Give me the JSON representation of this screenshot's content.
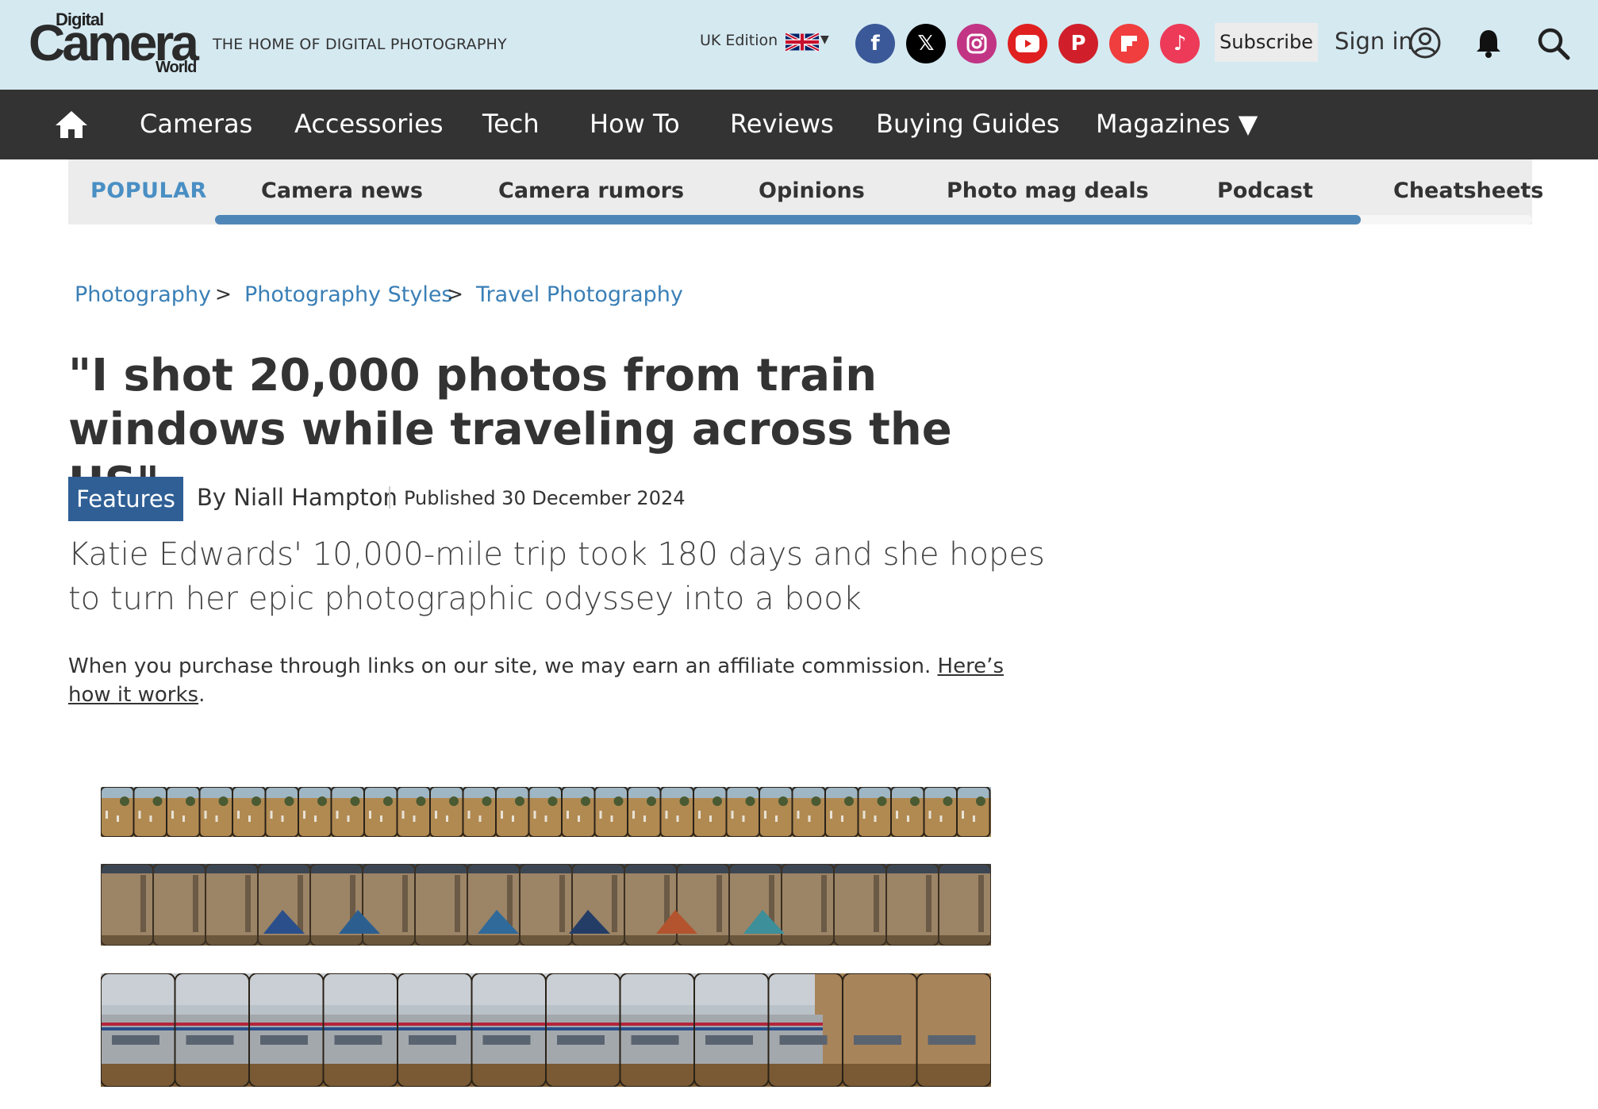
{
  "header": {
    "logo": {
      "digital": "Digital",
      "camera": "Camera",
      "world": "World"
    },
    "tagline": "THE HOME OF DIGITAL PHOTOGRAPHY",
    "edition": "UK Edition",
    "social": [
      "facebook-icon",
      "x-icon",
      "instagram-icon",
      "youtube-icon",
      "pinterest-icon",
      "flipboard-icon",
      "tiktok-icon"
    ],
    "subscribe_label": "Subscribe",
    "signin_label": "Sign in"
  },
  "nav": {
    "items": [
      "Cameras",
      "Accessories",
      "Tech",
      "How To",
      "Reviews",
      "Buying Guides",
      "Magazines ▼"
    ]
  },
  "popular": {
    "label": "POPULAR",
    "items": [
      "Camera news",
      "Camera rumors",
      "Opinions",
      "Photo mag deals",
      "Podcast",
      "Cheatsheets"
    ],
    "scroll_fraction": 0.87
  },
  "breadcrumbs": {
    "items": [
      "Photography",
      "Photography Styles",
      "Travel Photography"
    ],
    "separator": ">"
  },
  "article": {
    "headline": "\"I shot 20,000 photos from train windows while traveling across the US\"",
    "tag": "Features",
    "byline": "By Niall Hampton",
    "published": "Published 30 December 2024",
    "standfirst": "Katie Edwards' 10,000-mile trip took 180 days and she hopes to turn her epic photographic odyssey into a book",
    "affiliate_text": "When you purchase through links on our site, we may earn an affiliate commission. ",
    "affiliate_link": "Here’s how it works",
    "affiliate_end": "."
  },
  "colors": {
    "header_bg": "#d5e9f1",
    "nav_bg": "#333333",
    "accent": "#4a8fc4",
    "tag_bg": "#2f5f95"
  }
}
